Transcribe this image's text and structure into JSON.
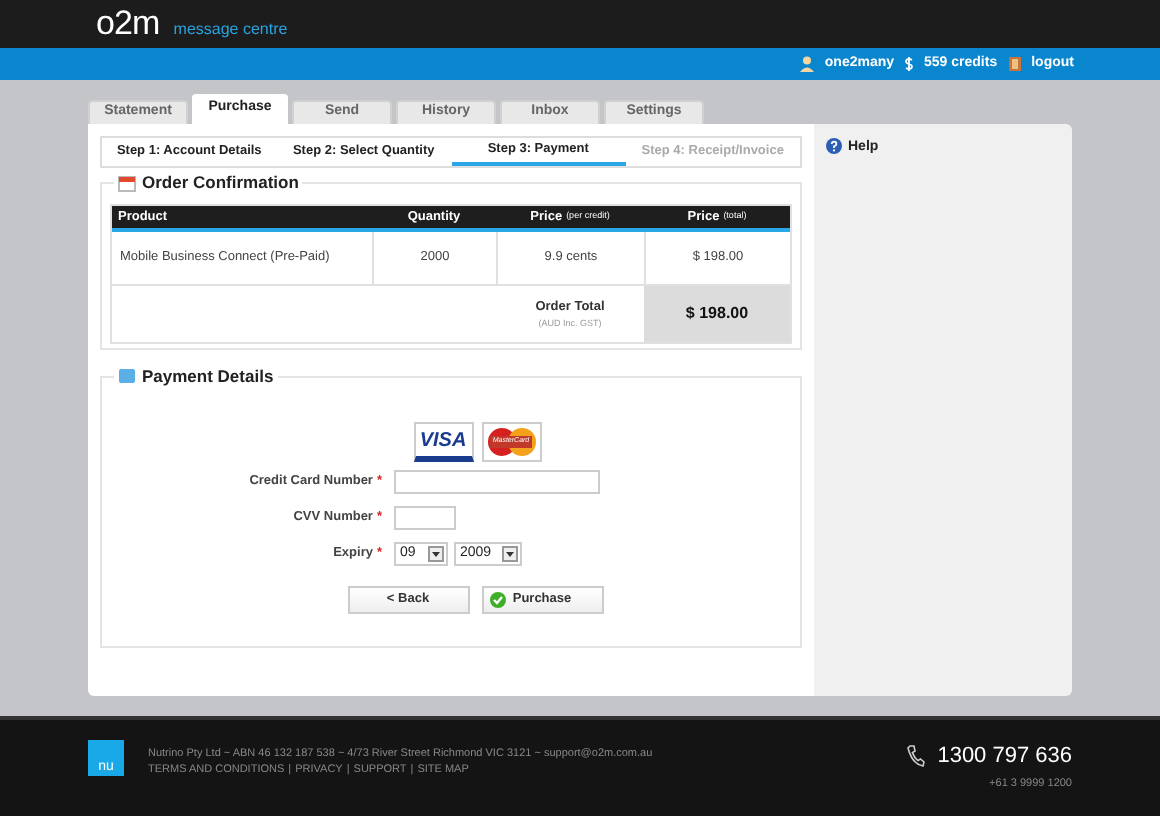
{
  "header": {
    "logo": "o2m",
    "subtitle": "message centre"
  },
  "userbar": {
    "username": "one2many",
    "credits": "559 credits",
    "logout": "logout"
  },
  "tabs": [
    {
      "label": "Statement",
      "selected": false
    },
    {
      "label": "Purchase",
      "selected": true
    },
    {
      "label": "Send",
      "selected": false
    },
    {
      "label": "History",
      "selected": false
    },
    {
      "label": "Inbox",
      "selected": false
    },
    {
      "label": "Settings",
      "selected": false
    }
  ],
  "steps": [
    {
      "label": "Step 1: Account Details",
      "selected": false,
      "disabled": false
    },
    {
      "label": "Step 2: Select Quantity",
      "selected": false,
      "disabled": false
    },
    {
      "label": "Step 3: Payment",
      "selected": true,
      "disabled": false
    },
    {
      "label": "Step 4: Receipt/Invoice",
      "selected": false,
      "disabled": true
    }
  ],
  "order": {
    "title": "Order Confirmation",
    "columns": [
      {
        "label": "Product"
      },
      {
        "label": "Quantity"
      },
      {
        "label": "Price",
        "note": "(per credit)"
      },
      {
        "label": "Price",
        "note": "(total)"
      }
    ],
    "rows": [
      [
        "Mobile Business Connect (Pre-Paid)",
        "2000",
        "9.9 cents",
        "$ 198.00"
      ]
    ],
    "total_label": "Order Total",
    "total_note": "(AUD Inc. GST)",
    "total": "$ 198.00"
  },
  "payment": {
    "title": "Payment Details",
    "required_mark": "*",
    "card_brands": [
      {
        "kind": "visa",
        "label": "VISA"
      },
      {
        "kind": "mastercard",
        "label": "MasterCard"
      }
    ],
    "fields": [
      {
        "kind": "long_text",
        "label": "Credit Card Number",
        "required": true
      },
      {
        "kind": "short_text",
        "label": "CVV Number",
        "required": true
      },
      {
        "kind": "selects",
        "label": "Expiry",
        "required": true,
        "values": [
          "09",
          "2009"
        ]
      }
    ],
    "buttons": [
      {
        "kind": "back",
        "label": "< Back"
      },
      {
        "kind": "submit",
        "label": "Purchase"
      }
    ]
  },
  "help": {
    "title": "Help"
  },
  "footer": {
    "company": "Nutrino Pty Ltd ~ ABN 46 132 187 538 ~ 4/73 River Street Richmond VIC 3121 ~ support@o2m.com.au",
    "links": [
      "TERMS AND CONDITIONS",
      "PRIVACY",
      "SUPPORT",
      "SITE MAP"
    ],
    "separator": "|",
    "phone": "1300 797 636",
    "alt_phone": "+61 3 9999 1200",
    "brand_logo": "nu"
  }
}
